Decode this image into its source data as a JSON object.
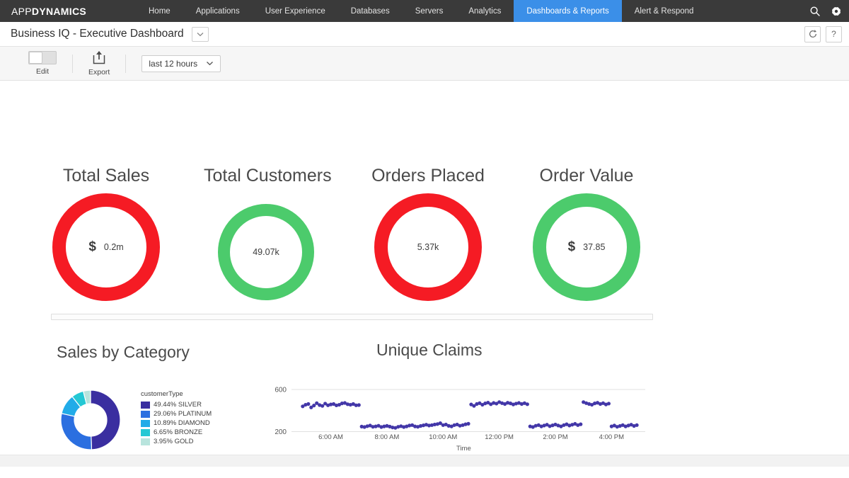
{
  "nav": {
    "brand_light": "APP",
    "brand_bold": "DYNAMICS",
    "items": [
      {
        "label": "Home",
        "active": false
      },
      {
        "label": "Applications",
        "active": false
      },
      {
        "label": "User Experience",
        "active": false
      },
      {
        "label": "Databases",
        "active": false
      },
      {
        "label": "Servers",
        "active": false
      },
      {
        "label": "Analytics",
        "active": false
      },
      {
        "label": "Dashboards & Reports",
        "active": true
      },
      {
        "label": "Alert & Respond",
        "active": false
      }
    ],
    "search_icon": "search-icon",
    "settings_icon": "gear-icon",
    "active_color": "#3b8fe8",
    "bar_color": "#3a3a3a"
  },
  "titlebar": {
    "title": "Business IQ - Executive Dashboard",
    "dropdown_icon": "chevron-down-icon",
    "refresh_label": "↻",
    "help_label": "?"
  },
  "toolbar": {
    "edit_label": "Edit",
    "edit_on": false,
    "export_label": "Export",
    "export_icon": "upload-icon",
    "time_range": "last 12 hours",
    "time_dropdown_icon": "chevron-down-icon"
  },
  "kpis": [
    {
      "title": "Total Sales",
      "currency": "$",
      "value": "0.2m",
      "color": "#f51b24"
    },
    {
      "title": "Total Customers",
      "currency": "",
      "value": "49.07k",
      "color": "#4ccb6c"
    },
    {
      "title": "Orders Placed",
      "currency": "",
      "value": "5.37k",
      "color": "#f51b24"
    },
    {
      "title": "Order Value",
      "currency": "$",
      "value": "37.85",
      "color": "#4ccb6c"
    }
  ],
  "panels": {
    "sales_by_category_title": "Sales by Category",
    "unique_claims_title": "Unique Claims"
  },
  "chart_data": [
    {
      "type": "pie",
      "title": "Sales by Category",
      "legend_title": "customerType",
      "legend_position": "right",
      "categories": [
        "SILVER",
        "PLATINUM",
        "DIAMOND",
        "BRONZE",
        "GOLD"
      ],
      "values": [
        49.44,
        29.06,
        10.89,
        6.65,
        3.95
      ],
      "labels": [
        "49.44% SILVER",
        "29.06% PLATINUM",
        "10.89% DIAMOND",
        "6.65% BRONZE",
        "3.95% GOLD"
      ],
      "colors": [
        "#3a2ea0",
        "#2b6fe0",
        "#21abe8",
        "#24c8d4",
        "#b8e4dd"
      ],
      "donut": true
    },
    {
      "type": "scatter",
      "title": "Unique Claims",
      "xlabel": "Time",
      "ylabel": "",
      "xticks": [
        "6:00 AM",
        "8:00 AM",
        "10:00 AM",
        "12:00 PM",
        "2:00 PM",
        "4:00 PM"
      ],
      "yticks": [
        200,
        600
      ],
      "ylim": [
        150,
        640
      ],
      "xlim": [
        4.6,
        17.2
      ],
      "grid": true,
      "point_color": "#4337a8",
      "series": [
        {
          "name": "Unique Claims",
          "x": [
            5.0,
            5.1,
            5.2,
            5.3,
            5.4,
            5.5,
            5.6,
            5.7,
            5.8,
            5.9,
            6.0,
            6.1,
            6.2,
            6.3,
            6.4,
            6.5,
            6.6,
            6.7,
            6.8,
            6.9,
            7.0,
            7.1,
            7.2,
            7.3,
            7.4,
            7.5,
            7.6,
            7.7,
            7.8,
            7.9,
            8.0,
            8.1,
            8.2,
            8.3,
            8.4,
            8.5,
            8.6,
            8.7,
            8.8,
            8.9,
            9.0,
            9.1,
            9.2,
            9.3,
            9.4,
            9.5,
            9.6,
            9.7,
            9.8,
            9.9,
            10.0,
            10.1,
            10.2,
            10.3,
            10.4,
            10.5,
            10.6,
            10.7,
            10.8,
            10.9,
            11.0,
            11.1,
            11.2,
            11.3,
            11.4,
            11.5,
            11.6,
            11.7,
            11.8,
            11.9,
            12.0,
            12.1,
            12.2,
            12.3,
            12.4,
            12.5,
            12.6,
            12.7,
            12.8,
            12.9,
            13.0,
            13.1,
            13.2,
            13.3,
            13.4,
            13.5,
            13.6,
            13.7,
            13.8,
            13.9,
            14.0,
            14.1,
            14.2,
            14.3,
            14.4,
            14.5,
            14.6,
            14.7,
            14.8,
            14.9,
            15.0,
            15.1,
            15.2,
            15.3,
            15.4,
            15.5,
            15.6,
            15.7,
            15.8,
            15.9,
            16.0,
            16.1,
            16.2,
            16.3,
            16.4,
            16.5,
            16.6,
            16.7,
            16.8,
            16.9
          ],
          "y": [
            440,
            455,
            462,
            430,
            448,
            470,
            452,
            444,
            466,
            450,
            458,
            462,
            449,
            455,
            468,
            472,
            460,
            455,
            462,
            450,
            452,
            248,
            244,
            252,
            258,
            246,
            250,
            256,
            244,
            250,
            255,
            248,
            240,
            236,
            246,
            252,
            244,
            250,
            258,
            262,
            250,
            246,
            254,
            260,
            266,
            258,
            262,
            268,
            272,
            280,
            262,
            268,
            255,
            250,
            262,
            268,
            256,
            262,
            270,
            275,
            458,
            444,
            462,
            470,
            455,
            468,
            475,
            460,
            472,
            466,
            480,
            470,
            462,
            474,
            468,
            458,
            466,
            472,
            462,
            470,
            460,
            250,
            244,
            256,
            262,
            250,
            258,
            266,
            252,
            260,
            268,
            258,
            250,
            262,
            270,
            258,
            266,
            274,
            262,
            270,
            480,
            470,
            462,
            455,
            468,
            474,
            462,
            470,
            458,
            466,
            250,
            258,
            246,
            254,
            262,
            250,
            258,
            266,
            254,
            262
          ]
        }
      ]
    }
  ]
}
